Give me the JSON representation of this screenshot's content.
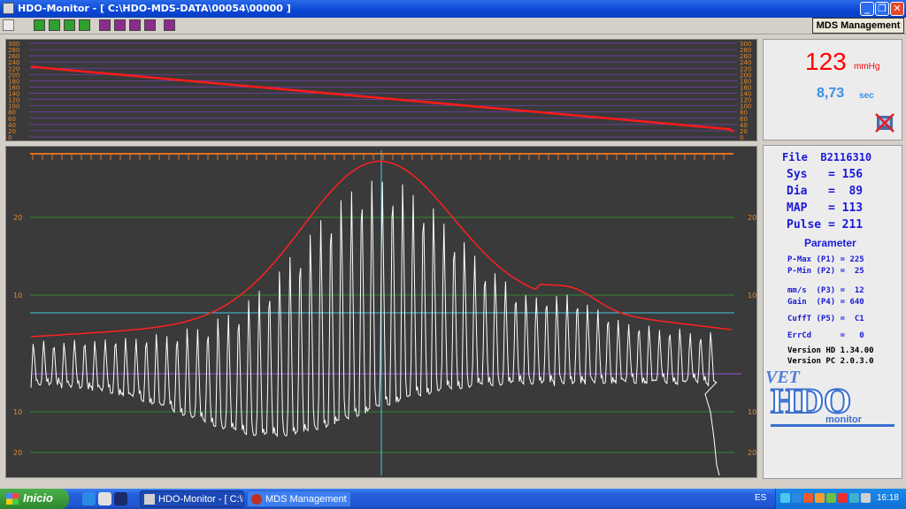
{
  "window": {
    "title": "HDO-Monitor - [ C:\\HDO-MDS-DATA\\00054\\00000 ]",
    "min_glyph": "_",
    "max_glyph": "❐",
    "close_glyph": "✕"
  },
  "toolbar": {
    "mds_button_label": "MDS Management",
    "icons": [
      "printer-icon",
      "arrow-left-icon",
      "arrow-right-icon",
      "arrow-up-icon",
      "arrow-down-icon",
      "grid-1-icon",
      "grid-2-icon",
      "grid-3-icon",
      "grid-4-icon",
      "grid-5-icon"
    ]
  },
  "top_chart": {
    "scale_labels": [
      "300",
      "280",
      "260",
      "240",
      "220",
      "200",
      "180",
      "160",
      "140",
      "120",
      "100",
      "80",
      "60",
      "40",
      "20",
      "0"
    ],
    "line_color": "#ff1a1a",
    "start_value": 225,
    "end_value": 22
  },
  "main_chart": {
    "y_labels_left": [
      "20",
      "10",
      "10",
      "20"
    ],
    "y_labels_right": [
      "20",
      "10",
      "10",
      "20"
    ],
    "trace_color": "#ffffff",
    "envelope_color": "#ff2020",
    "cyan_color": "#40c8e0",
    "purple_color": "#9b4fe0",
    "green_color": "#2e8b2e",
    "ruler_color": "#e07020"
  },
  "readout": {
    "pressure_value": "123",
    "pressure_unit": "mmHg",
    "time_value": "8,73",
    "time_unit": "sec"
  },
  "results": {
    "file_line": "File  B2116310",
    "sys_line": "Sys   = 156",
    "dia_line": "Dia   =  89",
    "map_line": "MAP   = 113",
    "pulse_line": "Pulse = 211",
    "parameter_title": "Parameter",
    "pmax_line": "P-Max (P1) = 225",
    "pmin_line": "P-Min (P2) =  25",
    "mms_line": "mm/s  (P3) =  12",
    "gain_line": "Gain  (P4) = 640",
    "cufft_line": "CuffT (P5) =  C1",
    "errcd_line": "ErrCd      =   0",
    "version_hd": "Version HD 1.34.00",
    "version_pc": "Version PC 2.0.3.0"
  },
  "logo": {
    "text_vet": "VET",
    "text_hdo": "HDO",
    "text_monitor": "monitor"
  },
  "taskbar": {
    "start_label": "Inicio",
    "tasks": [
      "HDO-Monitor - [ C:\\H...",
      "MDS Management"
    ],
    "language": "ES",
    "clock": "16:18"
  }
}
